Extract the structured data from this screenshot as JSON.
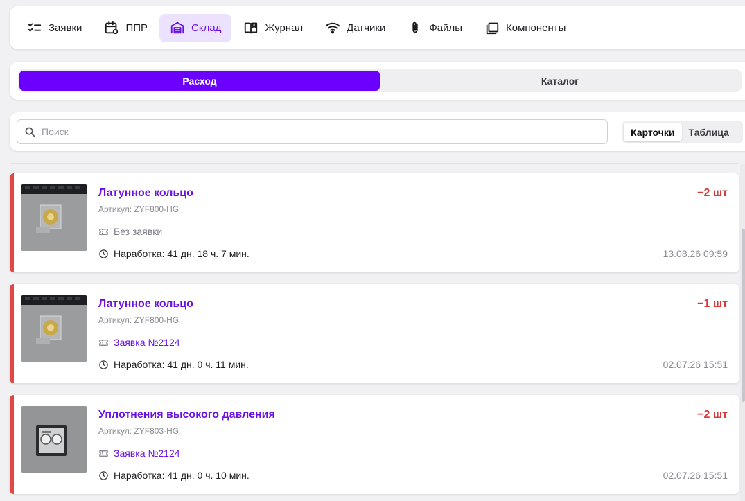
{
  "nav": {
    "items": [
      {
        "label": "Заявки",
        "icon": "checklist-icon",
        "active": false
      },
      {
        "label": "ППР",
        "icon": "calendar-icon",
        "active": false
      },
      {
        "label": "Склад",
        "icon": "warehouse-icon",
        "active": true
      },
      {
        "label": "Журнал",
        "icon": "book-icon",
        "active": false
      },
      {
        "label": "Датчики",
        "icon": "wifi-icon",
        "active": false
      },
      {
        "label": "Файлы",
        "icon": "paperclip-icon",
        "active": false
      },
      {
        "label": "Компоненты",
        "icon": "folders-icon",
        "active": false
      }
    ]
  },
  "segment": {
    "tabs": [
      {
        "label": "Расход",
        "active": true
      },
      {
        "label": "Каталог",
        "active": false
      }
    ]
  },
  "search": {
    "placeholder": "Поиск",
    "value": ""
  },
  "view_toggle": {
    "options": [
      {
        "label": "Карточки",
        "active": true
      },
      {
        "label": "Таблица",
        "active": false
      }
    ]
  },
  "cards": [
    {
      "title": "Латунное кольцо",
      "article": "Артикул: ZYF800-HG",
      "ticket": "Без заявки",
      "ticket_is_link": false,
      "runtime": "Наработка: 41 дн. 18 ч. 7 мин.",
      "quantity": "−2 шт",
      "date": "13.08.26 09:59"
    },
    {
      "title": "Латунное кольцо",
      "article": "Артикул: ZYF800-HG",
      "ticket": "Заявка №2124",
      "ticket_is_link": true,
      "runtime": "Наработка: 41 дн. 0 ч. 11 мин.",
      "quantity": "−1 шт",
      "date": "02.07.26 15:51"
    },
    {
      "title": "Уплотнения высокого давления",
      "article": "Артикул: ZYF803-HG",
      "ticket": "Заявка №2124",
      "ticket_is_link": true,
      "runtime": "Наработка: 41 дн. 0 ч. 10 мин.",
      "quantity": "−2 шт",
      "date": "02.07.26 15:51"
    }
  ],
  "colors": {
    "accent": "#6b00ff",
    "accent_text": "#6a10e6",
    "active_nav_bg": "#ece2ff",
    "negative": "#d93a3a",
    "card_stripe": "#e04848"
  }
}
